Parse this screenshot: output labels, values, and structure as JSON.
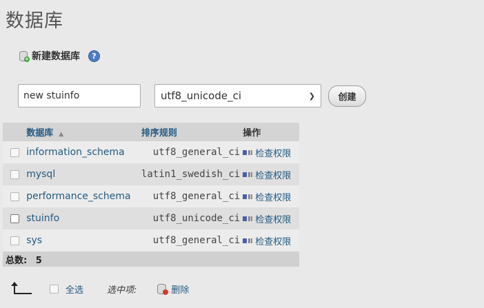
{
  "page": {
    "title": "数据库"
  },
  "create": {
    "label": "新建数据库",
    "help_icon": "help-icon",
    "name_value": "new stuinfo",
    "collation_value": "utf8_unicode_ci",
    "button_label": "创建"
  },
  "table": {
    "headers": {
      "name": "数据库",
      "collation": "排序规则",
      "actions": "操作"
    },
    "rows": [
      {
        "name": "information_schema",
        "collation": "utf8_general_ci",
        "action": "检查权限"
      },
      {
        "name": "mysql",
        "collation": "latin1_swedish_ci",
        "action": "检查权限"
      },
      {
        "name": "performance_schema",
        "collation": "utf8_general_ci",
        "action": "检查权限"
      },
      {
        "name": "stuinfo",
        "collation": "utf8_unicode_ci",
        "action": "检查权限"
      },
      {
        "name": "sys",
        "collation": "utf8_general_ci",
        "action": "检查权限"
      }
    ],
    "total_label": "总数:",
    "total_value": "5"
  },
  "footer": {
    "select_all": "全选",
    "with_selected": "选中项:",
    "delete": "删除"
  }
}
